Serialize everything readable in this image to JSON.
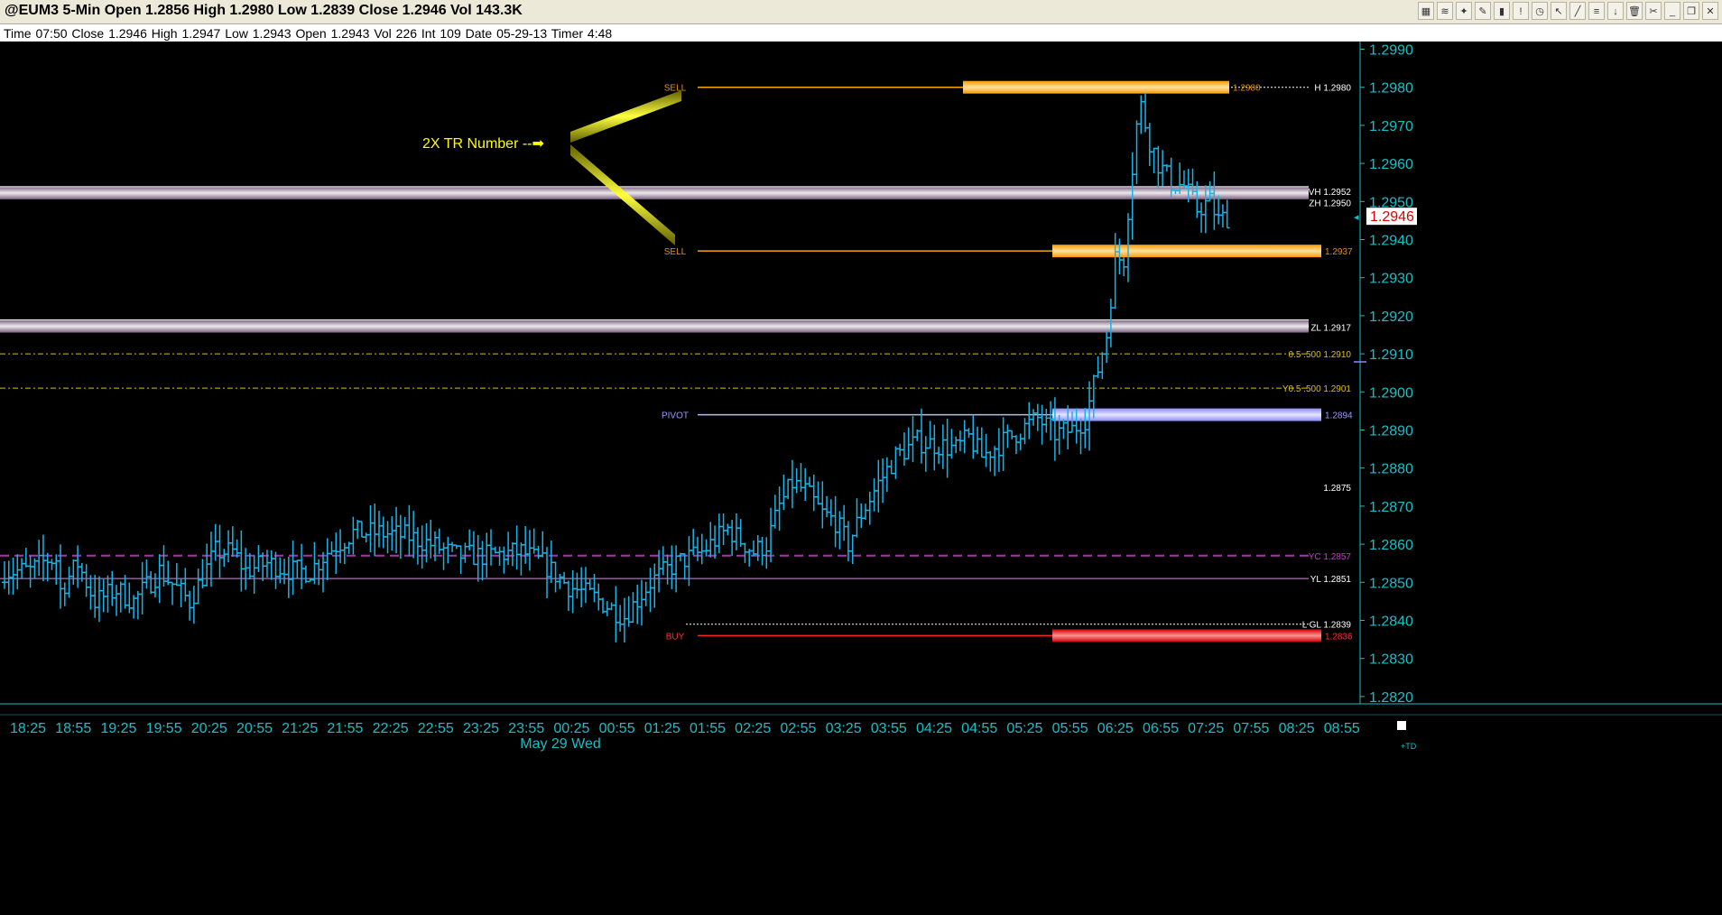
{
  "window": {
    "title": "@EUM3 5-Min Open 1.2856 High 1.2980 Low 1.2839 Close 1.2946 Vol 143.3K",
    "toolbar_icons": [
      "chart-style-icon",
      "indicator-icon",
      "drawing-icon",
      "pencil-icon",
      "bar-chart-icon",
      "alert-icon",
      "clock-icon",
      "cursor-icon",
      "line-tool-icon",
      "fibonacci-icon",
      "arrow-down-icon",
      "trash-icon",
      "pin-icon",
      "minimize-icon",
      "restore-icon",
      "close-icon"
    ],
    "toolbar_glyphs": [
      "▦",
      "≋",
      "✦",
      "✎",
      "▮",
      "!",
      "◷",
      "↖",
      "╱",
      "≡",
      "↓",
      "🗑",
      "✂",
      "_",
      "❐",
      "✕"
    ]
  },
  "infobar": {
    "text": "Time 07:50   Close 1.2946   High 1.2947   Low 1.2943   Open 1.2943   Vol 226   Int 109   Date 05-29-13   Timer 4:48"
  },
  "colors": {
    "background": "#000000",
    "axis": "#17bfc6",
    "bars": "#18b4e8",
    "sell_band": "#ffa500",
    "buy_band": "#ff2020",
    "pivot_band": "#b8b8ff",
    "zone_band": "#d8b8e0",
    "fib_line": "#d8c010",
    "yc_line": "#b030b0",
    "yl_line": "#d890e0",
    "arrow": "#ffff00"
  },
  "chart_data": {
    "type": "bar",
    "title": "",
    "ylim": [
      1.2814,
      1.2993
    ],
    "y_ticks": [
      "1.2990",
      "1.2980",
      "1.2970",
      "1.2960",
      "1.2950",
      "1.2940",
      "1.2930",
      "1.2920",
      "1.2910",
      "1.2900",
      "1.2890",
      "1.2880",
      "1.2870",
      "1.2860",
      "1.2850",
      "1.2840",
      "1.2830",
      "1.2820"
    ],
    "last_price": "1.2946",
    "x_ticks": [
      "18:25",
      "18:55",
      "19:25",
      "19:55",
      "20:25",
      "20:55",
      "21:25",
      "21:55",
      "22:25",
      "22:55",
      "23:25",
      "23:55",
      "00:25",
      "00:55",
      "01:25",
      "01:55",
      "02:25",
      "02:55",
      "03:25",
      "03:55",
      "04:25",
      "04:55",
      "05:25",
      "05:55",
      "06:25",
      "06:55",
      "07:25",
      "07:55",
      "08:25",
      "08:55"
    ],
    "date_label": "May 29 Wed",
    "scale_label": "+TD",
    "anchors": [
      [
        0,
        1.2853
      ],
      [
        6,
        1.2853
      ],
      [
        10,
        1.2856
      ],
      [
        12,
        1.2856
      ],
      [
        13,
        1.2848
      ],
      [
        17,
        1.2855
      ],
      [
        21,
        1.2845
      ],
      [
        26,
        1.2848
      ],
      [
        30,
        1.2845
      ],
      [
        36,
        1.2853
      ],
      [
        43,
        1.2845
      ],
      [
        49,
        1.2858
      ],
      [
        53,
        1.2858
      ],
      [
        56,
        1.2853
      ],
      [
        61,
        1.2855
      ],
      [
        67,
        1.2853
      ],
      [
        71,
        1.2853
      ],
      [
        75,
        1.2858
      ],
      [
        81,
        1.2863
      ],
      [
        87,
        1.2863
      ],
      [
        94,
        1.2862
      ],
      [
        99,
        1.286
      ],
      [
        105,
        1.2857
      ],
      [
        112,
        1.2857
      ],
      [
        120,
        1.2858
      ],
      [
        125,
        1.2855
      ],
      [
        131,
        1.2849
      ],
      [
        137,
        1.2846
      ],
      [
        144,
        1.2841
      ],
      [
        150,
        1.285
      ],
      [
        156,
        1.2855
      ],
      [
        162,
        1.2858
      ],
      [
        168,
        1.2864
      ],
      [
        174,
        1.2858
      ],
      [
        177,
        1.286
      ],
      [
        180,
        1.287
      ],
      [
        183,
        1.2876
      ],
      [
        186,
        1.2874
      ],
      [
        190,
        1.2868
      ],
      [
        193,
        1.2866
      ],
      [
        196,
        1.286
      ],
      [
        199,
        1.2868
      ],
      [
        203,
        1.2876
      ],
      [
        207,
        1.2883
      ],
      [
        212,
        1.2887
      ],
      [
        217,
        1.2886
      ],
      [
        221,
        1.2885
      ],
      [
        224,
        1.2888
      ],
      [
        227,
        1.2883
      ],
      [
        232,
        1.2887
      ],
      [
        236,
        1.289
      ],
      [
        240,
        1.2893
      ],
      [
        244,
        1.2889
      ],
      [
        248,
        1.289
      ],
      [
        251,
        1.2893
      ],
      [
        254,
        1.2906
      ],
      [
        256,
        1.2915
      ],
      [
        258,
        1.2935
      ],
      [
        260,
        1.2935
      ],
      [
        261,
        1.2948
      ],
      [
        263,
        1.297
      ],
      [
        264,
        1.2975
      ],
      [
        266,
        1.2966
      ],
      [
        268,
        1.296
      ],
      [
        271,
        1.2955
      ],
      [
        274,
        1.2954
      ],
      [
        277,
        1.2948
      ],
      [
        280,
        1.295
      ],
      [
        282,
        1.2945
      ],
      [
        284,
        1.2946
      ]
    ],
    "levels": [
      {
        "name": "SELL",
        "left_label": "SELL",
        "right_label": "1.2980",
        "price": 1.298,
        "style": "band",
        "color": "#ffa500",
        "band_start": 1.288,
        "line_start": 0.493,
        "text_color": "#e89000"
      },
      {
        "name": "H",
        "right_label": "H 1.2980",
        "price": 1.298,
        "style": "dotted",
        "color": "#ffffff"
      },
      {
        "name": "VH",
        "right_label": "VH 1.2952",
        "price": 1.2952,
        "style": "zone",
        "color": "#d8b8e0"
      },
      {
        "name": "ZH",
        "right_label": "ZH 1.2950",
        "price": 1.295,
        "style": "label",
        "color": "#ffffff"
      },
      {
        "name": "SELL",
        "left_label": "SELL",
        "right_label": "1.2937",
        "price": 1.2937,
        "style": "band",
        "color": "#ffa500",
        "band_start": 1.297,
        "line_start": 0.493,
        "text_color": "#e89000"
      },
      {
        "name": "ZL",
        "right_label": "ZL 1.2917",
        "price": 1.2917,
        "style": "zone",
        "color": "#d8b8e0"
      },
      {
        "name": "0.5",
        "right_label": "0.5  .500  1.2910",
        "price": 1.291,
        "style": "dashdot",
        "color": "#d8c010",
        "text_color": "#d8c010"
      },
      {
        "name": "Y0.5",
        "right_label": "Y0.5  .500  1.2901",
        "price": 1.2901,
        "style": "dashdot",
        "color": "#d8c010",
        "text_color": "#d8c010"
      },
      {
        "name": "PIVOT",
        "left_label": "PIVOT",
        "right_label": "1.2894",
        "price": 1.2894,
        "style": "band",
        "color": "#b8b8ff",
        "band_start": 1.297,
        "line_start": 0.493,
        "text_color": "#9a9aff"
      },
      {
        "name": "1.2875",
        "right_label": "1.2875",
        "price": 1.2875,
        "style": "label",
        "color": "#ffffff"
      },
      {
        "name": "YC",
        "right_label": "YC 1.2857",
        "price": 1.2857,
        "style": "dashed",
        "color": "#b030b0",
        "text_color": "#c040c0"
      },
      {
        "name": "YL",
        "right_label": "YL 1.2851",
        "price": 1.2851,
        "style": "solid",
        "color": "#d890e0"
      },
      {
        "name": "L GL",
        "right_label": "L  GL 1.2839",
        "price": 1.2839,
        "style": "dotted",
        "color": "#ffffff"
      },
      {
        "name": "BUY",
        "left_label": "BUY",
        "right_label": "1.2836",
        "price": 1.2836,
        "style": "band",
        "color": "#ff2020",
        "band_start": 1.297,
        "line_start": 0.493,
        "text_color": "#ff3030"
      }
    ],
    "annotation": {
      "text": "2X TR Number  --➡",
      "color": "#ffff00"
    }
  }
}
